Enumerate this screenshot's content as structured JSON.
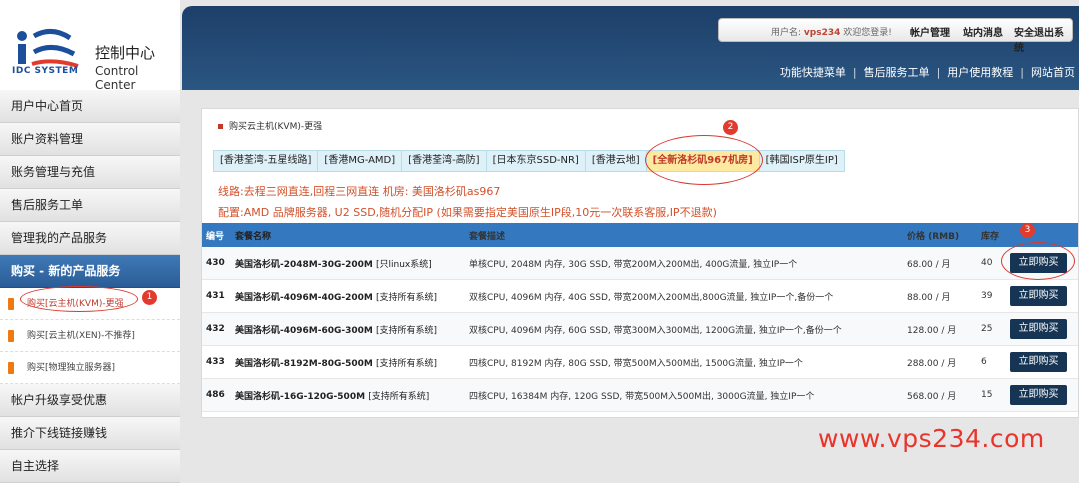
{
  "logo": {
    "brand": "IDC SYSTEM",
    "title_cn": "控制中心",
    "title_en": "Control Center"
  },
  "header": {
    "user_label": "用户名:",
    "username": "vps234",
    "welcome": "欢迎您登录!",
    "links": [
      "帐户管理",
      "站内消息",
      "安全退出系统"
    ],
    "nav": [
      "功能快捷菜单",
      "售后服务工单",
      "用户使用教程",
      "网站首页"
    ]
  },
  "sidebar": {
    "items": [
      "用户中心首页",
      "账户资料管理",
      "账务管理与充值",
      "售后服务工单",
      "管理我的产品服务",
      "购买 - 新的产品服务"
    ],
    "subitems": [
      "购买[云主机(KVM)-更强",
      "购买[云主机(XEN)-不推荐]",
      "购买[物理独立服务器]"
    ],
    "items_after": [
      "帐户升级享受优惠",
      "推介下线链接赚钱",
      "自主选择"
    ]
  },
  "main": {
    "section_title": "购买云主机(KVM)-更强",
    "tabs": [
      "[香港荃湾-五星线路]",
      "[香港MG-AMD]",
      "[香港荃湾-高防]",
      "[日本东京SSD-NR]",
      "[香港云地]",
      "[全新洛杉矶967机房]",
      "[韩国ISP原生IP]"
    ],
    "selected_tab": 5,
    "line_info": "线路:去程三网直连,回程三网直连 机房: 美国洛杉矶as967",
    "config_info": "配置:AMD 品牌服务器, U2 SSD,随机分配IP (如果需要指定美国原生IP段,10元一次联系客服,IP不退款)",
    "table": {
      "headers": {
        "id": "编号",
        "name": "套餐名称",
        "desc": "套餐描述",
        "price": "价格 (RMB)",
        "stock": "库存"
      },
      "rows": [
        {
          "id": "430",
          "name": "美国洛杉矶-2048M-30G-200M",
          "tag": "[只linux系统]",
          "desc": "单核CPU, 2048M 内存, 30G SSD, 带宽200M入200M出, 400G流量, 独立IP一个",
          "price": "68.00 / 月",
          "stock": "40",
          "buy": "立即购买"
        },
        {
          "id": "431",
          "name": "美国洛杉矶-4096M-40G-200M",
          "tag": "[支持所有系统]",
          "desc": "双核CPU, 4096M 内存, 40G SSD, 带宽200M入200M出,800G流量, 独立IP一个,备份一个",
          "price": "88.00 / 月",
          "stock": "39",
          "buy": "立即购买"
        },
        {
          "id": "432",
          "name": "美国洛杉矶-4096M-60G-300M",
          "tag": "[支持所有系统]",
          "desc": "双核CPU, 4096M 内存, 60G SSD, 带宽300M入300M出, 1200G流量, 独立IP一个,备份一个",
          "price": "128.00 / 月",
          "stock": "25",
          "buy": "立即购买"
        },
        {
          "id": "433",
          "name": "美国洛杉矶-8192M-80G-500M",
          "tag": "[支持所有系统]",
          "desc": "四核CPU, 8192M 内存, 80G SSD, 带宽500M入500M出, 1500G流量, 独立IP一个",
          "price": "288.00 / 月",
          "stock": "6",
          "buy": "立即购买"
        },
        {
          "id": "486",
          "name": "美国洛杉矶-16G-120G-500M",
          "tag": "[支持所有系统]",
          "desc": "四核CPU, 16384M 内存, 120G SSD, 带宽500M入500M出, 3000G流量, 独立IP一个",
          "price": "568.00 / 月",
          "stock": "15",
          "buy": "立即购买"
        }
      ]
    }
  },
  "annotations": {
    "badges": [
      "1",
      "2",
      "3"
    ]
  },
  "watermark": "www.vps234.com",
  "colors": {
    "header": "#1d3f68",
    "table_header": "#3479bf",
    "active_sidebar": "#2a5d97",
    "buy_button": "#163554",
    "annotation": "#d93a30",
    "info_text": "#d2502a"
  }
}
